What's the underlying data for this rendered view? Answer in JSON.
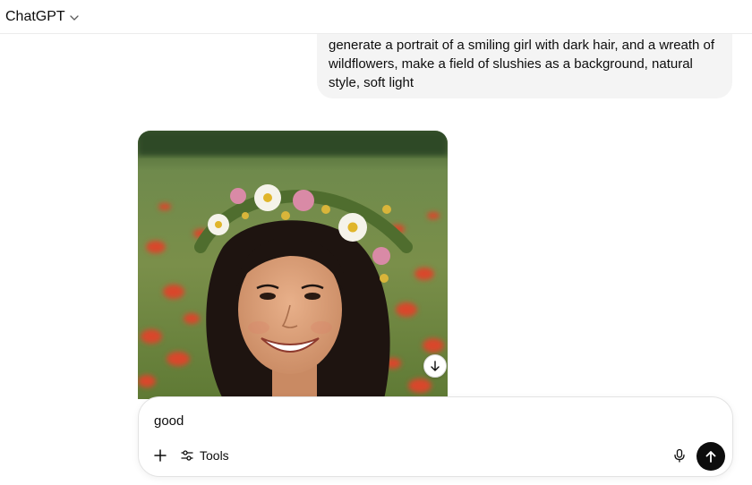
{
  "header": {
    "model_name": "ChatGPT"
  },
  "conversation": {
    "user_message": "generate a portrait of a smiling girl with dark hair, and a wreath of wildflowers, make a field of slushies as a background, natural style, soft light"
  },
  "composer": {
    "input_value": "good",
    "tools_label": "Tools"
  },
  "icons": {
    "model_dropdown": "chevron-down-icon",
    "download": "arrow-down-icon",
    "add": "plus-icon",
    "tools": "sliders-icon",
    "mic": "microphone-icon",
    "send": "arrow-up-icon"
  },
  "colors": {
    "bubble_bg": "#f4f4f4",
    "send_bg": "#0d0d0d",
    "field_green": "#5a7a3a",
    "poppy_red": "#d9472b"
  }
}
